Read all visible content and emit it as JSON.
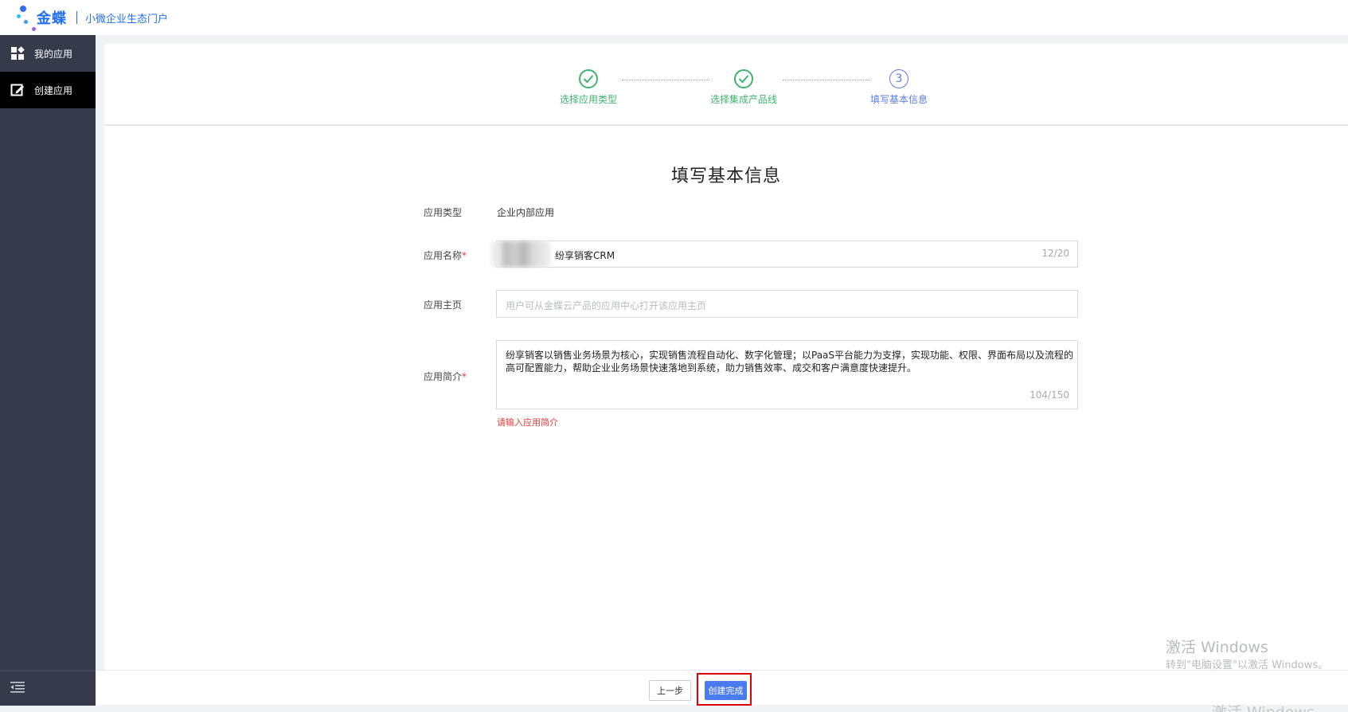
{
  "header": {
    "brand": "金蝶",
    "subtitle": "小微企业生态门户"
  },
  "sidebar": {
    "items": [
      {
        "label": "我的应用",
        "icon": "grid-apps-icon"
      },
      {
        "label": "创建应用",
        "icon": "edit-square-icon"
      }
    ],
    "collapse_icon": "collapse-menu-icon"
  },
  "steps": [
    {
      "label": "选择应用类型",
      "status": "done"
    },
    {
      "label": "选择集成产品线",
      "status": "done"
    },
    {
      "label": "填写基本信息",
      "status": "current",
      "number": "3"
    }
  ],
  "form": {
    "title": "填写基本信息",
    "app_type_label": "应用类型",
    "app_type_value": "企业内部应用",
    "app_name_label": "应用名称",
    "app_name_value": "纷享销客CRM",
    "app_name_counter": "12/20",
    "homepage_label": "应用主页",
    "homepage_placeholder": "用户可从金蝶云产品的应用中心打开该应用主页",
    "desc_label": "应用简介",
    "desc_value": "纷享销客以销售业务场景为核心，实现销售流程自动化、数字化管理；以PaaS平台能力为支撑，实现功能、权限、界面布局以及流程的高可配置能力，帮助企业业务场景快速落地到系统，助力销售效率、成交和客户满意度快速提升。",
    "desc_counter": "104/150",
    "desc_error": "请输入应用简介",
    "required_mark": "*"
  },
  "footer": {
    "prev_label": "上一步",
    "done_label": "创建完成"
  },
  "watermark": {
    "line1": "激活 Windows",
    "line2": "转到\"电脑设置\"以激活 Windows。",
    "line3": "激活 Windows"
  },
  "colors": {
    "sidebar_bg": "#363b4b",
    "brand_blue": "#1f6ef4",
    "step_done": "#3db46d",
    "step_current": "#5b7ce6",
    "primary_button": "#4a7cf0",
    "error_red": "#e53935",
    "highlight_box": "#e00000"
  }
}
